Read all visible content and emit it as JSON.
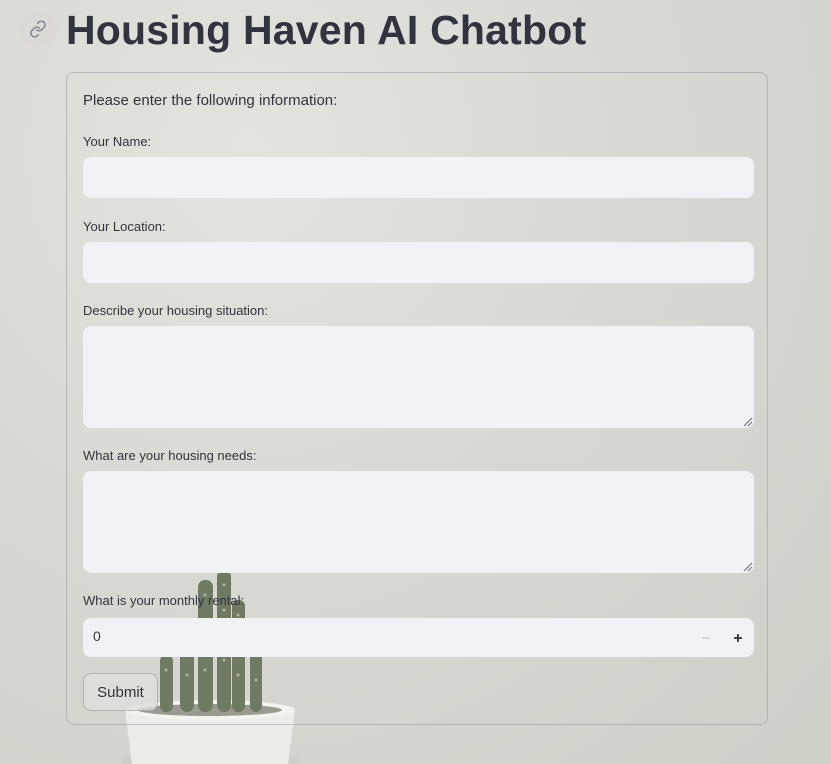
{
  "header": {
    "title": "Housing Haven AI Chatbot",
    "link_icon": "link-icon"
  },
  "form": {
    "intro": "Please enter the following information:",
    "name": {
      "label": "Your Name:",
      "value": ""
    },
    "location": {
      "label": "Your Location:",
      "value": ""
    },
    "situation": {
      "label": "Describe your housing situation:",
      "value": ""
    },
    "needs": {
      "label": "What are your housing needs:",
      "value": ""
    },
    "rental": {
      "label": "What is your monthly rental:",
      "value": "0",
      "decrement_icon": "minus-icon",
      "increment_icon": "plus-icon"
    },
    "submit_label": "Submit"
  },
  "colors": {
    "text": "#31333f",
    "input_bg": "#f0f2f6",
    "background": "#d9d9d3"
  }
}
